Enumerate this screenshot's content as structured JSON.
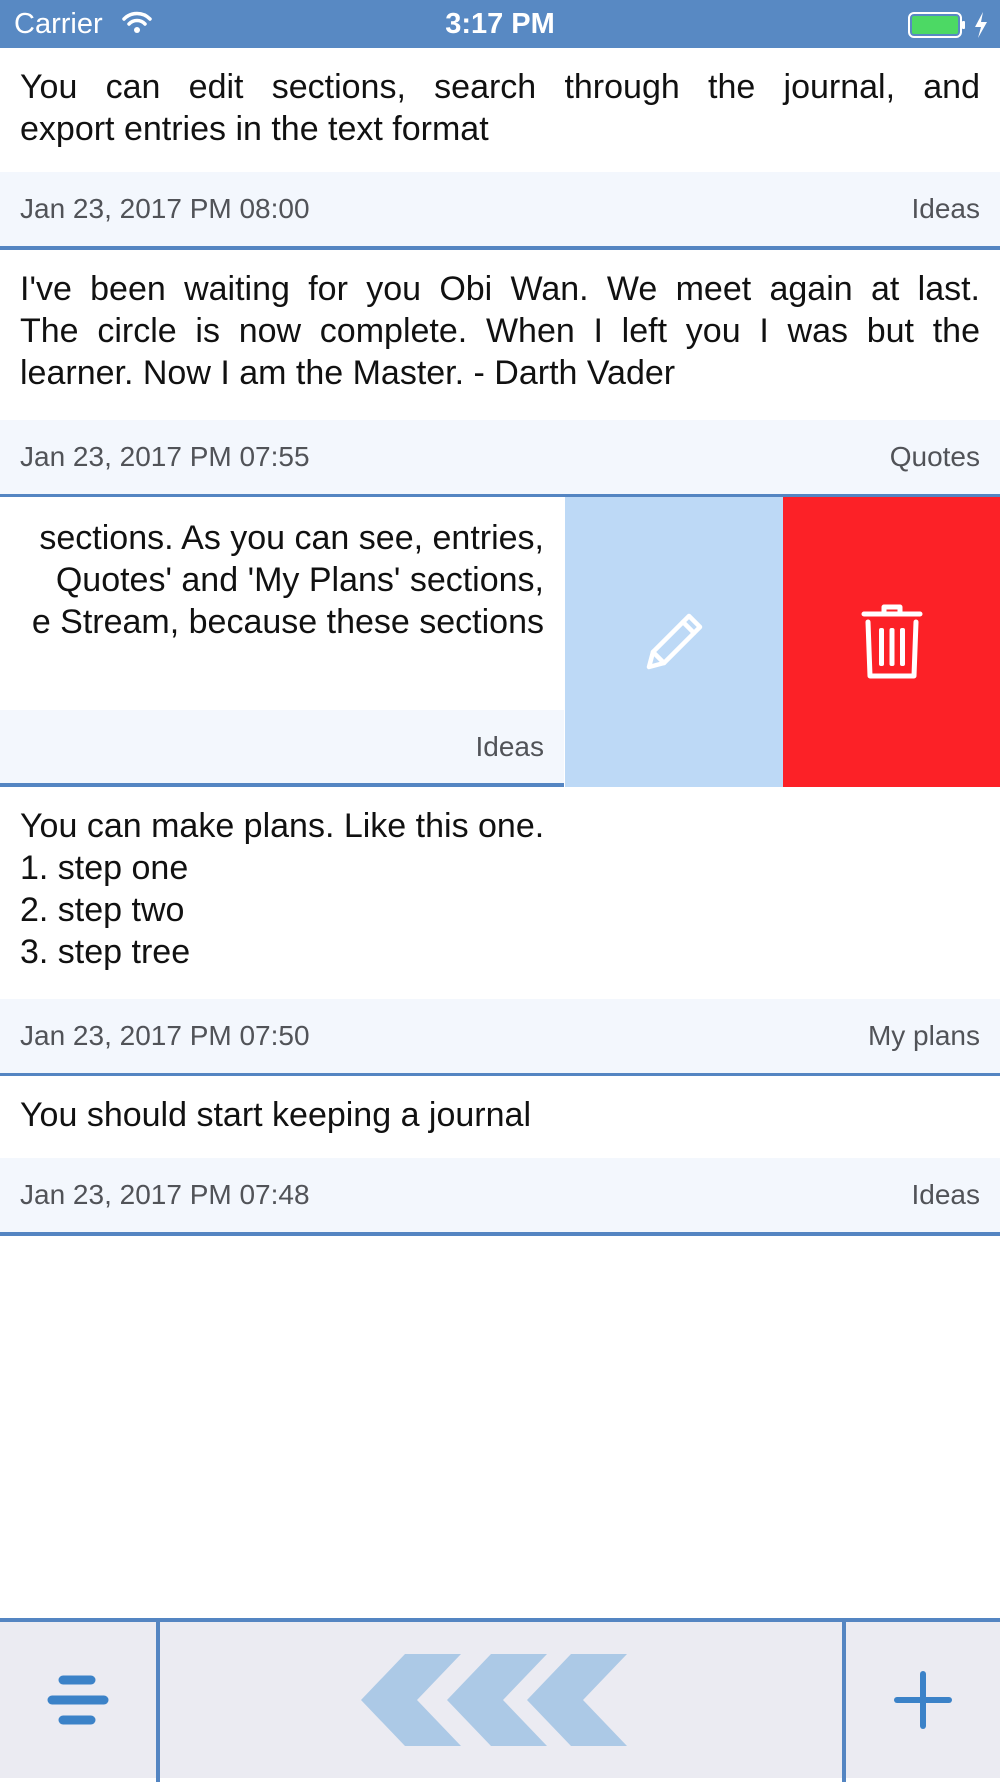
{
  "status_bar": {
    "carrier": "Carrier",
    "time": "3:17 PM",
    "icons": [
      "wifi-icon",
      "battery-icon",
      "charging-bolt-icon"
    ]
  },
  "entries": [
    {
      "text_lines": [
        "You can edit sections, search through the journal, and",
        "export entries in the text format"
      ],
      "date": "Jan 23, 2017 PM 08:00",
      "section": "Ideas"
    },
    {
      "text_lines": [
        "I've been waiting for you Obi Wan. We meet again at last.",
        "The circle is now complete. When I left you I was but the",
        "learner. Now I am the Master. - Darth Vader"
      ],
      "date": "Jan 23, 2017 PM 07:55",
      "section": "Quotes"
    },
    {
      "text_lines": [
        "sections. As you can see, entries,",
        "Quotes' and 'My Plans' sections,",
        "e Stream, because these sections"
      ],
      "date": "",
      "section": "Ideas",
      "swiped": true
    },
    {
      "text_lines": [
        "You can make plans. Like this one.",
        "1. step one",
        "2. step two",
        "3. step tree"
      ],
      "date": "Jan 23, 2017 PM 07:50",
      "section": "My plans"
    },
    {
      "text_lines": [
        "You should start keeping a journal"
      ],
      "date": "Jan 23, 2017 PM 07:48",
      "section": "Ideas"
    }
  ],
  "swipe_actions": {
    "edit_icon": "pencil-icon",
    "delete_icon": "trash-icon",
    "edit_color": "#bdd9f6",
    "delete_color": "#fc2127"
  },
  "toolbar": {
    "menu_icon": "menu-icon",
    "back_icon": "triple-chevron-left-icon",
    "add_icon": "plus-icon"
  },
  "colors": {
    "accent": "#5485c2",
    "status_bar": "#5889c3",
    "meta_background": "#f3f7fd",
    "toolbar_background": "#ebebf2"
  }
}
